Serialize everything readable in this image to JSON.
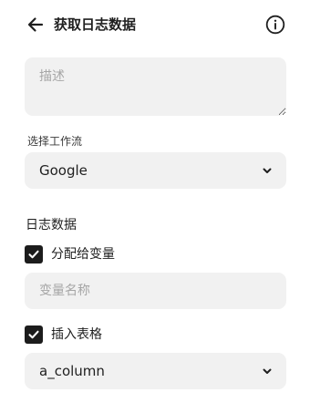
{
  "header": {
    "title": "获取日志数据",
    "back_icon": "arrow-left-icon",
    "info_icon": "info-circle-icon"
  },
  "description": {
    "placeholder": "描述",
    "value": ""
  },
  "workflow": {
    "label": "选择工作流",
    "selected": "Google",
    "icon": "chevron-down-icon"
  },
  "log_data": {
    "section_title": "日志数据",
    "assign_variable": {
      "label": "分配给变量",
      "checked": true,
      "placeholder": "变量名称"
    },
    "insert_table": {
      "label": "插入表格",
      "checked": true,
      "selected_column": "a_column"
    }
  },
  "colors": {
    "field_background": "#f1f1f1",
    "checkbox": "#1c1c1c",
    "placeholder": "#a6a6a6"
  }
}
